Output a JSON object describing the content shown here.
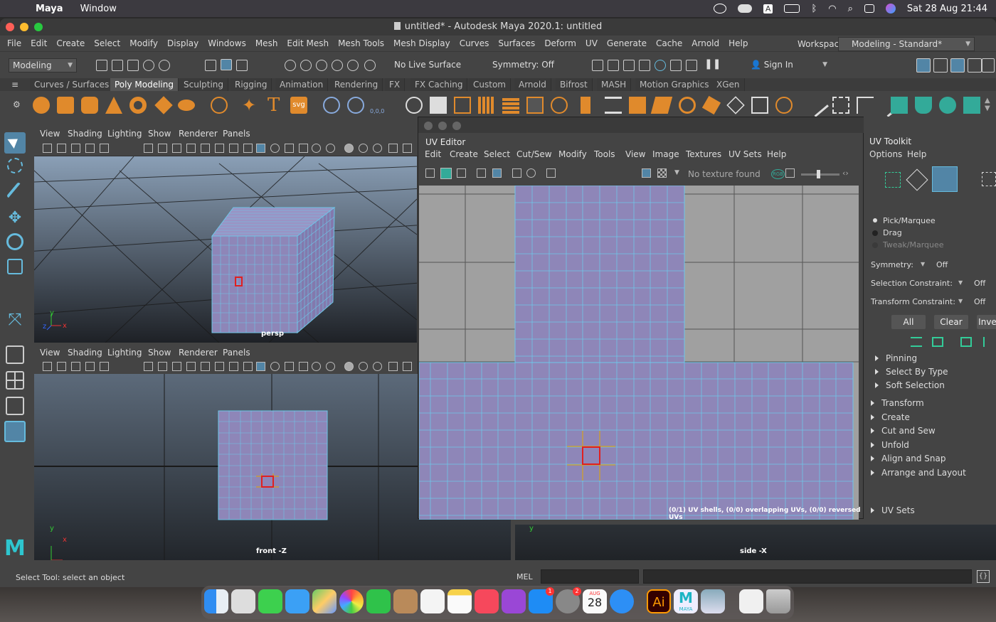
{
  "macos": {
    "apple": "",
    "app_name": "Maya",
    "window_menu": "Window",
    "input_indicator": "A",
    "datetime": "Sat 28 Aug  21:44"
  },
  "window": {
    "title": "untitled* - Autodesk Maya 2020.1: untitled"
  },
  "menubar": [
    "File",
    "Edit",
    "Create",
    "Select",
    "Modify",
    "Display",
    "Windows",
    "Mesh",
    "Edit Mesh",
    "Mesh Tools",
    "Mesh Display",
    "Curves",
    "Surfaces",
    "Deform",
    "UV",
    "Generate",
    "Cache",
    "Arnold",
    "Help"
  ],
  "workspace": {
    "label": "Workspace :",
    "value": "Modeling - Standard*"
  },
  "statusline": {
    "mode": "Modeling",
    "live_surface": "No Live Surface",
    "symmetry": "Symmetry: Off",
    "sign_in": "Sign In"
  },
  "shelf_tabs": [
    "Curves / Surfaces",
    "Poly Modeling",
    "Sculpting",
    "Rigging",
    "Animation",
    "Rendering",
    "FX",
    "FX Caching",
    "Custom",
    "Arnold",
    "Bifrost",
    "MASH",
    "Motion Graphics",
    "XGen"
  ],
  "shelf_active": "Poly Modeling",
  "shelf": {
    "svg_label": "svg",
    "coords": "0,0,0"
  },
  "viewport_menu": [
    "View",
    "Shading",
    "Lighting",
    "Show",
    "Renderer",
    "Panels"
  ],
  "viewports": {
    "persp": "persp",
    "front": "front -Z",
    "side": "side -X"
  },
  "axes": {
    "x": "x",
    "y": "y",
    "z": "z"
  },
  "uv_editor": {
    "title": "UV Editor",
    "menu": [
      "Edit",
      "Create",
      "Select",
      "Cut/Sew",
      "Modify",
      "Tools",
      "View",
      "Image",
      "Textures",
      "UV Sets",
      "Help"
    ],
    "texture": "No texture found",
    "rgb": "RGB",
    "status": "(0/1) UV shells, (0/0) overlapping UVs, (0/0) reversed UVs"
  },
  "uv_toolkit": {
    "title": "UV Toolkit",
    "menu": [
      "Options",
      "Help"
    ],
    "modes": [
      "Pick/Marquee",
      "Drag",
      "Tweak/Marquee"
    ],
    "symmetry_label": "Symmetry:",
    "symmetry_value": "Off",
    "sel_constraint_label": "Selection Constraint:",
    "sel_constraint_value": "Off",
    "xf_constraint_label": "Transform Constraint:",
    "xf_constraint_value": "Off",
    "buttons": [
      "All",
      "Clear",
      "Inve"
    ],
    "sub_sections": [
      "Pinning",
      "Select By Type",
      "Soft Selection"
    ],
    "sections": [
      "Transform",
      "Create",
      "Cut and Sew",
      "Unfold",
      "Align and Snap",
      "Arrange and Layout"
    ],
    "uv_sets": "UV Sets"
  },
  "helpline": {
    "text": "Select Tool: select an object",
    "mel": "MEL"
  },
  "dock": {
    "illustrator": "Ai",
    "maya_label": "MAYA",
    "calendar_month": "AUG",
    "calendar_day": "28",
    "badge1": "1",
    "badge2": "2"
  },
  "colors": {
    "uv_fill": "#8e86b8",
    "uv_line": "#6ec6e8",
    "selection": "#e02020",
    "accent_blue": "#5285a6"
  }
}
